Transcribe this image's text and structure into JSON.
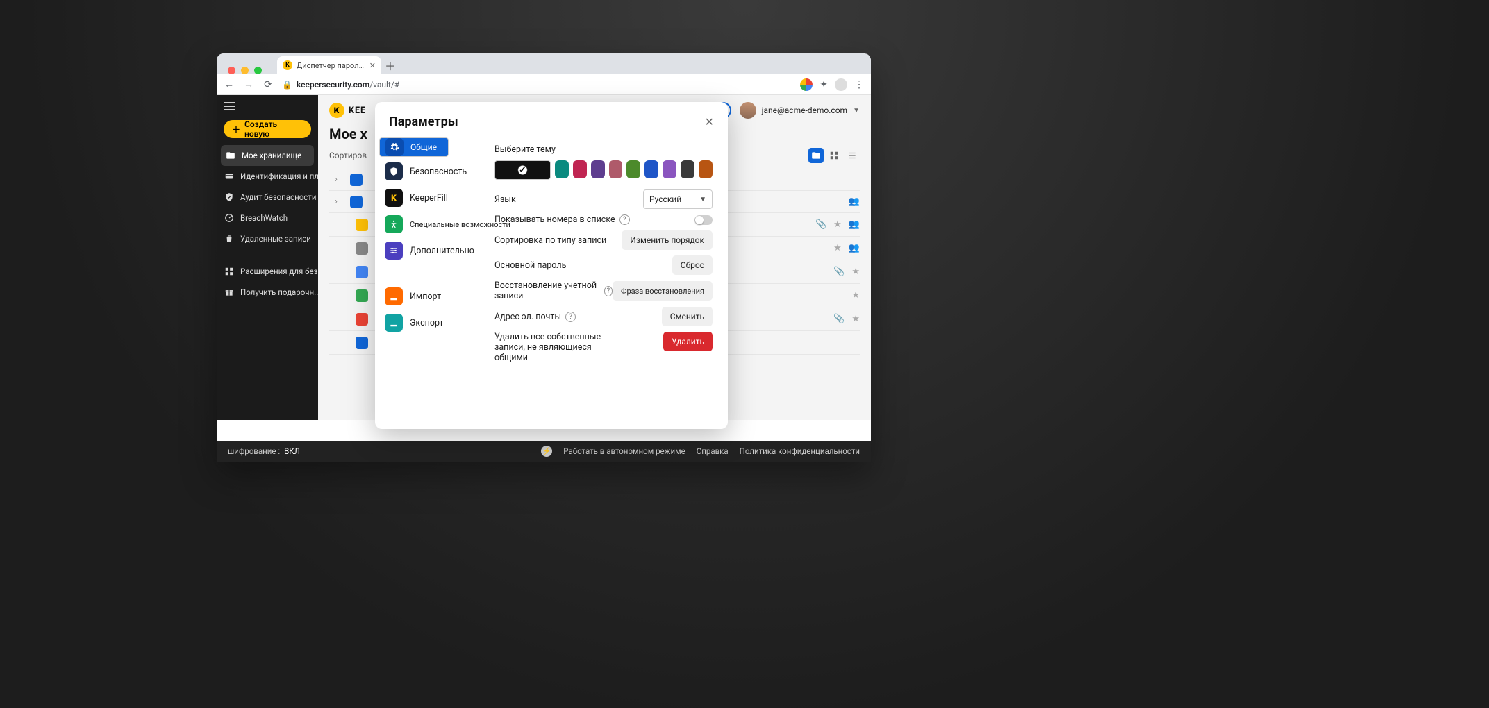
{
  "browser": {
    "tab_title": "Диспетчер паролей и циф",
    "url_host": "keepersecurity.com",
    "url_path": "/vault/#"
  },
  "sidebar": {
    "create_label": "Создать новую",
    "items": [
      "Мое хранилище",
      "Идентификация и пл...",
      "Аудит безопасности",
      "BreachWatch",
      "Удаленные записи"
    ],
    "bottom": [
      "Расширения для без...",
      "Получить подарочн..."
    ]
  },
  "topbar": {
    "logo_text": "KEE",
    "user_email": "jane@acme-demo.com"
  },
  "main": {
    "title_partial": "Мое х",
    "sort_label_partial": "Сортиров"
  },
  "modal": {
    "title": "Параметры",
    "tabs": [
      "Общие",
      "Безопасность",
      "KeeperFill",
      "Специальные возможности",
      "Дополнительно",
      "Импорт",
      "Экспорт"
    ],
    "labels": {
      "theme": "Выберите тему",
      "language": "Язык",
      "language_value": "Русский",
      "show_numbers": "Показывать номера в списке",
      "sort_type": "Сортировка по типу записи",
      "change_order": "Изменить порядок",
      "master_pw": "Основной пароль",
      "reset": "Сброс",
      "recovery": "Восстановление учетной записи",
      "recovery_phrase": "Фраза восстановления",
      "email": "Адрес эл. почты",
      "change": "Сменить",
      "delete_all": "Удалить все собственные записи, не являющиеся общими",
      "delete": "Удалить"
    },
    "theme_colors": [
      "#111111",
      "#0b8a7f",
      "#c02552",
      "#5e3d8f",
      "#af5a6a",
      "#4c8a2b",
      "#1e55c7",
      "#8a55bf",
      "#3a3a3a",
      "#b85512"
    ]
  },
  "footer": {
    "enc_label": "шифрование :",
    "enc_value": "ВКЛ",
    "offline": "Работать в автономном режиме",
    "help": "Справка",
    "privacy": "Политика конфиденциальности"
  }
}
